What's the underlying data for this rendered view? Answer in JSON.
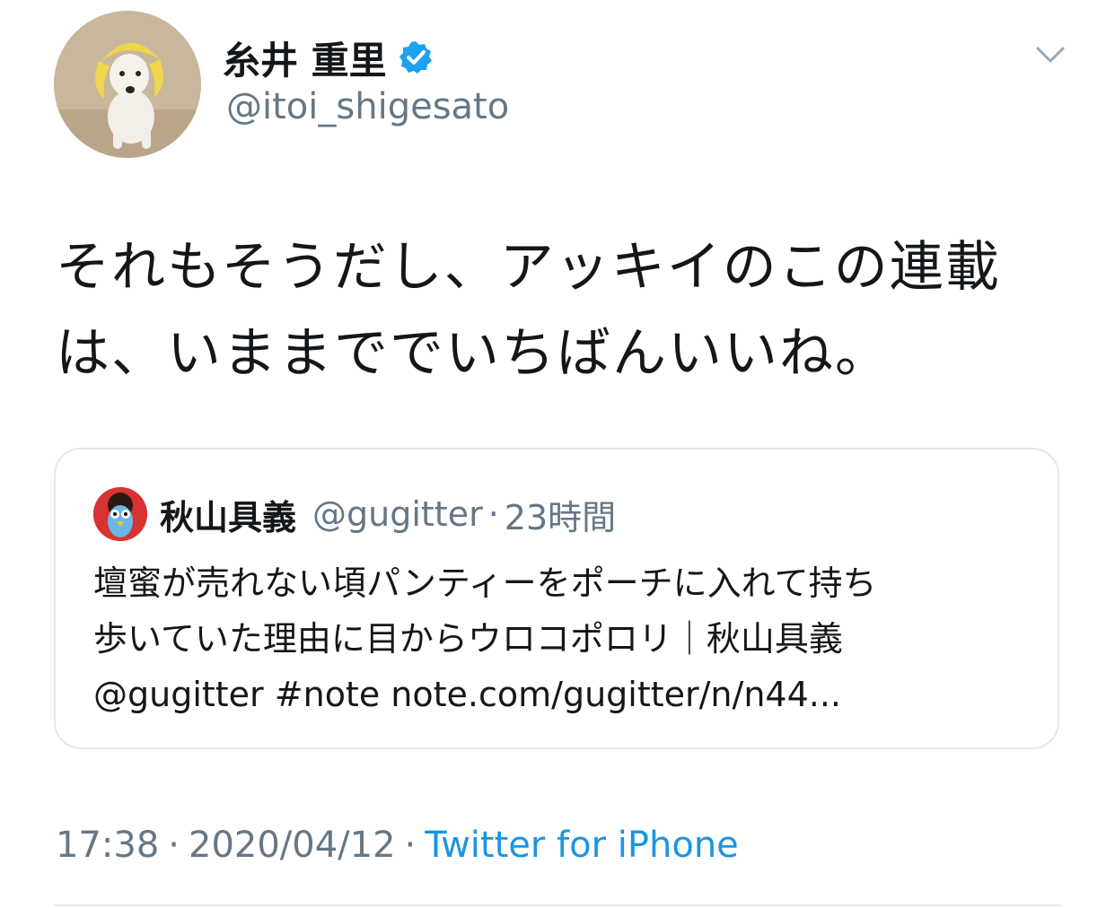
{
  "author": {
    "display_name": "糸井 重里",
    "handle": "@itoi_shigesato",
    "verified_icon": "verified-badge-icon",
    "avatar_icon": "dog-avatar-icon"
  },
  "menu": {
    "icon": "chevron-down-icon"
  },
  "tweet": {
    "text": "それもそうだし、アッキイのこの連載は、いままででいちばんいいね。"
  },
  "quote": {
    "display_name": "秋山具義",
    "handle": "@gugitter",
    "separator": "·",
    "time": "23時間",
    "avatar_icon": "bird-avatar-icon",
    "lines": [
      "壇蜜が売れない頃パンティーをポーチに入れて持ち",
      "歩いていた理由に目からウロコポロリ｜秋山具義",
      "@gugitter #note note.com/gugitter/n/n44..."
    ]
  },
  "meta": {
    "time": "17:38",
    "separator": "·",
    "date": "2020/04/12",
    "source": "Twitter for iPhone"
  },
  "colors": {
    "text": "#14171a",
    "secondary": "#657786",
    "link": "#1b95e0",
    "verified": "#1da1f2",
    "border": "#e1e8ed"
  }
}
